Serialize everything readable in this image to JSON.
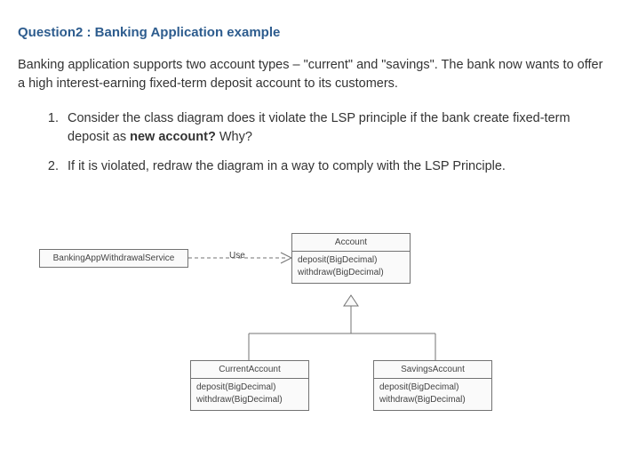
{
  "title": "Question2 : Banking Application example",
  "intro": "Banking application supports two account types – \"current\" and \"savings\". The bank now wants to offer a high interest-earning fixed-term deposit account to its customers.",
  "q1_pre": "Consider the class diagram does it violate the LSP principle if the bank create ",
  "q1_mid": "fixed-term deposit",
  "q1_post": " as ",
  "q1_bold": "new account?",
  "q1_end": " Why?",
  "q2": "If it is violated, redraw the diagram in a way to comply with the LSP Principle.",
  "diagram": {
    "use_label": "Use",
    "service": {
      "name": "BankingAppWithdrawalService"
    },
    "account": {
      "name": "Account",
      "m1": "deposit(BigDecimal)",
      "m2": "withdraw(BigDecimal)"
    },
    "current": {
      "name": "CurrentAccount",
      "m1": "deposit(BigDecimal)",
      "m2": "withdraw(BigDecimal)"
    },
    "savings": {
      "name": "SavingsAccount",
      "m1": "deposit(BigDecimal)",
      "m2": "withdraw(BigDecimal)"
    }
  }
}
